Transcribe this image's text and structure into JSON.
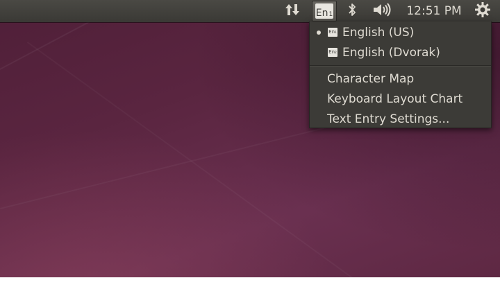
{
  "panel": {
    "clock": "12:51 PM",
    "keyboard_indicator": {
      "base": "En",
      "index": "1"
    },
    "icons": {
      "network": "network-transfer-icon",
      "bluetooth": "bluetooth-icon",
      "sound": "volume-icon",
      "session": "gear-icon"
    }
  },
  "keyboard_menu": {
    "layouts": [
      {
        "label": "English (US)",
        "badge": "En₁",
        "selected": true
      },
      {
        "label": "English (Dvorak)",
        "badge": "En₂",
        "selected": false
      }
    ],
    "actions": [
      {
        "label": "Character Map"
      },
      {
        "label": "Keyboard Layout Chart"
      },
      {
        "label": "Text Entry Settings..."
      }
    ]
  },
  "colors": {
    "panel_bg": "#3c3b37",
    "menu_bg": "#3c3b37",
    "text": "#dfdbd2",
    "wallpaper": "#5a2540"
  }
}
